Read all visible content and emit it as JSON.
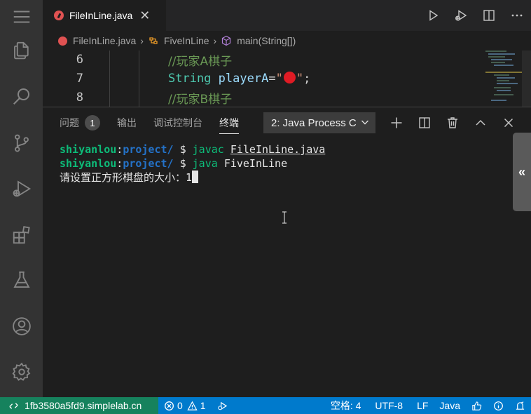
{
  "editor": {
    "tab": {
      "label": "FileInLine.java",
      "close": "✕"
    },
    "breadcrumb": [
      "FileInLine.java",
      "FiveInLine",
      "main(String[])"
    ],
    "lines": [
      {
        "number": "6",
        "comment": "//玩家A棋子"
      },
      {
        "number": "7",
        "keyword": "String",
        "variable": "playerA",
        "eq": "=",
        "quote_open": "\"",
        "quote_close": "\"",
        "semicolon": ";"
      },
      {
        "number": "8",
        "comment": "//玩家B棋子"
      }
    ]
  },
  "panel": {
    "tabs": [
      {
        "label": "问题",
        "badge": "1"
      },
      {
        "label": "输出"
      },
      {
        "label": "调试控制台"
      },
      {
        "label": "终端"
      }
    ],
    "terminal_select": "2: Java Process C",
    "side_handle": "«"
  },
  "terminal": {
    "lines": [
      {
        "user": "shiyanlou",
        "colon": ":",
        "path": "project/",
        "dollar": " $ ",
        "cmd": "javac",
        "arg": "FileInLine.java"
      },
      {
        "user": "shiyanlou",
        "colon": ":",
        "path": "project/",
        "dollar": " $ ",
        "cmd": "java",
        "arg": "FiveInLine"
      }
    ],
    "prompt": "请设置正方形棋盘的大小：",
    "input": "1"
  },
  "statusbar": {
    "remote": "1fb3580a5fd9.simplelab.cn",
    "errors": "0",
    "warnings": "1",
    "indent": "空格: 4",
    "encoding": "UTF-8",
    "eol": "LF",
    "language": "Java"
  },
  "colors": {
    "accent": "#007acc",
    "remote": "#16825d",
    "activity_bar": "#333333",
    "editor_bg": "#1e1e1e"
  }
}
